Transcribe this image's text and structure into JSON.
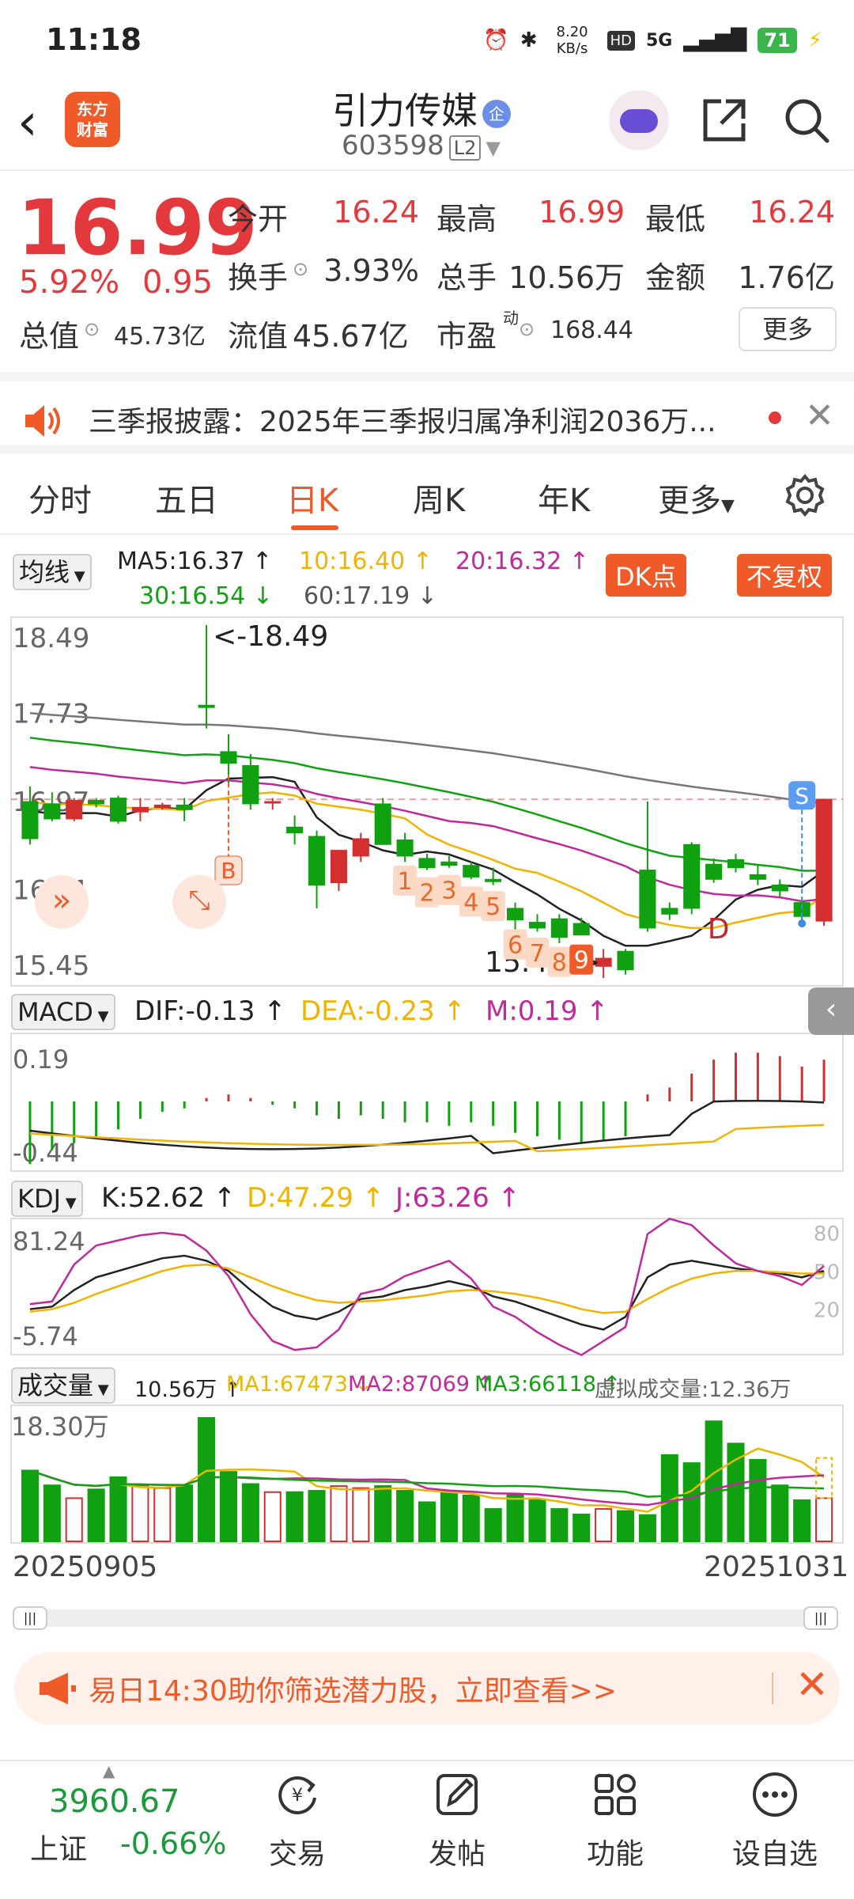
{
  "status": {
    "time": "11:18",
    "speed": "8.20 KB/s",
    "network": "5G",
    "battery": "71"
  },
  "header": {
    "logo_text": "东方财富",
    "stock_name": "引力传媒",
    "badge": "企",
    "code": "603598",
    "level": "L2"
  },
  "quote": {
    "price": "16.99",
    "change_pct": "5.92%",
    "change": "0.95",
    "rows": [
      [
        {
          "label": "今开",
          "value": "16.24",
          "red": true
        },
        {
          "label": "最高",
          "value": "16.99",
          "red": true
        },
        {
          "label": "最低",
          "value": "16.24",
          "red": true
        }
      ],
      [
        {
          "label": "换手",
          "value": "3.93%",
          "red": false
        },
        {
          "label": "总手",
          "value": "10.56万",
          "red": false
        },
        {
          "label": "金额",
          "value": "1.76亿",
          "red": false
        }
      ]
    ],
    "total_cap_label": "总值",
    "total_cap": "45.73亿",
    "float_cap_label": "流值",
    "float_cap": "45.67亿",
    "pe_label": "市盈",
    "pe_sup": "动",
    "pe": "168.44",
    "more": "更多"
  },
  "news": {
    "text": "三季报披露：2025年三季报归属净利润2036万..."
  },
  "tabs": [
    "分时",
    "五日",
    "日K",
    "周K",
    "年K",
    "更多"
  ],
  "active_tab": 2,
  "chart": {
    "ma_button": "均线",
    "ma": [
      {
        "text": "MA5:16.37 ↑",
        "color": "#222222"
      },
      {
        "text": "10:16.40 ↑",
        "color": "#f0b400"
      },
      {
        "text": "20:16.32 ↑",
        "color": "#c0299a"
      },
      {
        "text": "30:16.54 ↓",
        "color": "#12a112"
      },
      {
        "text": "60:17.19 ↓",
        "color": "#555555"
      }
    ],
    "dk_button": "DK点",
    "fq_button": "不复权",
    "price_axis": [
      "18.49",
      "17.73",
      "16.97",
      "16.21",
      "15.45"
    ],
    "high_marker": "<-18.49",
    "low_marker": "15.45->",
    "signal_b": "B",
    "signal_s": "S",
    "signal_d": "D",
    "td_counts": [
      "1",
      "2",
      "3",
      "4",
      "5",
      "6",
      "7",
      "8",
      "9"
    ],
    "macd": {
      "button": "MACD",
      "dif": "DIF:-0.13 ↑",
      "dea": "DEA:-0.23 ↑",
      "m": "M:0.19 ↑",
      "axis_top": "0.19",
      "axis_bottom": "-0.44"
    },
    "kdj": {
      "button": "KDJ",
      "k": "K:52.62 ↑",
      "d": "D:47.29 ↑",
      "j": "J:63.26 ↑",
      "axis_top": "81.24",
      "axis_bottom": "-5.74",
      "ref_levels": [
        "80",
        "50",
        "20"
      ]
    },
    "volume": {
      "button": "成交量",
      "vol": "10.56万 ↑",
      "ma1": "MA1:67473 ↓",
      "ma2": "MA2:87069 ↑",
      "ma3": "MA3:66118 ↑",
      "virtual": "虚拟成交量:12.36万",
      "axis_top": "18.30万"
    },
    "date_start": "20250905",
    "date_end": "20251031",
    "candles": [
      [
        16.97,
        17.1,
        16.6,
        16.65
      ],
      [
        16.95,
        17.05,
        16.8,
        16.82
      ],
      [
        16.82,
        17.0,
        16.8,
        16.98
      ],
      [
        16.98,
        17.0,
        16.92,
        16.95
      ],
      [
        17.0,
        17.02,
        16.78,
        16.8
      ],
      [
        16.88,
        17.0,
        16.8,
        16.92
      ],
      [
        16.92,
        16.96,
        16.9,
        16.94
      ],
      [
        16.94,
        17.0,
        16.8,
        16.9
      ],
      [
        17.8,
        18.49,
        17.6,
        17.78
      ],
      [
        17.4,
        17.55,
        17.1,
        17.3
      ],
      [
        17.28,
        17.38,
        16.9,
        16.95
      ],
      [
        16.97,
        17.0,
        16.9,
        16.97
      ],
      [
        16.75,
        16.85,
        16.6,
        16.7
      ],
      [
        16.67,
        16.72,
        16.05,
        16.25
      ],
      [
        16.27,
        16.55,
        16.2,
        16.55
      ],
      [
        16.5,
        16.7,
        16.45,
        16.65
      ],
      [
        16.95,
        17.0,
        16.6,
        16.6
      ],
      [
        16.64,
        16.7,
        16.45,
        16.5
      ],
      [
        16.48,
        16.52,
        16.38,
        16.4
      ],
      [
        16.45,
        16.5,
        16.4,
        16.42
      ],
      [
        16.42,
        16.45,
        16.3,
        16.32
      ],
      [
        16.3,
        16.4,
        16.25,
        16.28
      ],
      [
        16.05,
        16.1,
        15.8,
        15.95
      ],
      [
        15.93,
        16.0,
        15.85,
        15.88
      ],
      [
        15.96,
        16.0,
        15.75,
        15.8
      ],
      [
        15.92,
        15.97,
        15.82,
        15.82
      ],
      [
        15.55,
        15.7,
        15.45,
        15.62
      ],
      [
        15.68,
        15.7,
        15.48,
        15.52
      ],
      [
        16.38,
        16.97,
        15.85,
        15.88
      ],
      [
        16.05,
        16.1,
        15.95,
        16.0
      ],
      [
        16.6,
        16.62,
        16.0,
        16.05
      ],
      [
        16.43,
        16.48,
        16.27,
        16.3
      ],
      [
        16.47,
        16.52,
        16.36,
        16.4
      ],
      [
        16.34,
        16.42,
        16.25,
        16.3
      ],
      [
        16.25,
        16.3,
        16.15,
        16.2
      ],
      [
        16.1,
        16.15,
        15.9,
        15.98
      ],
      [
        15.94,
        16.96,
        15.9,
        16.99
      ]
    ],
    "volumes": [
      10.5,
      8.3,
      6.4,
      7.7,
      9.5,
      8.3,
      7.9,
      8.3,
      18.3,
      10.3,
      8.5,
      7.3,
      7.3,
      7.5,
      8.2,
      7.9,
      8.2,
      7.5,
      5.8,
      7.2,
      6.8,
      4.8,
      6.9,
      6.2,
      4.8,
      4.0,
      4.8,
      4.5,
      3.9,
      12.8,
      11.6,
      17.8,
      14.5,
      12.1,
      8.3,
      6.1,
      6.4,
      11.4
    ]
  },
  "promo": {
    "text": "易日14:30助你筛选潜力股，立即查看>>"
  },
  "bottom": {
    "index_value": "3960.67",
    "index_name": "上证",
    "index_change": "-0.66%",
    "nav": [
      "交易",
      "发帖",
      "功能",
      "设自选"
    ]
  }
}
